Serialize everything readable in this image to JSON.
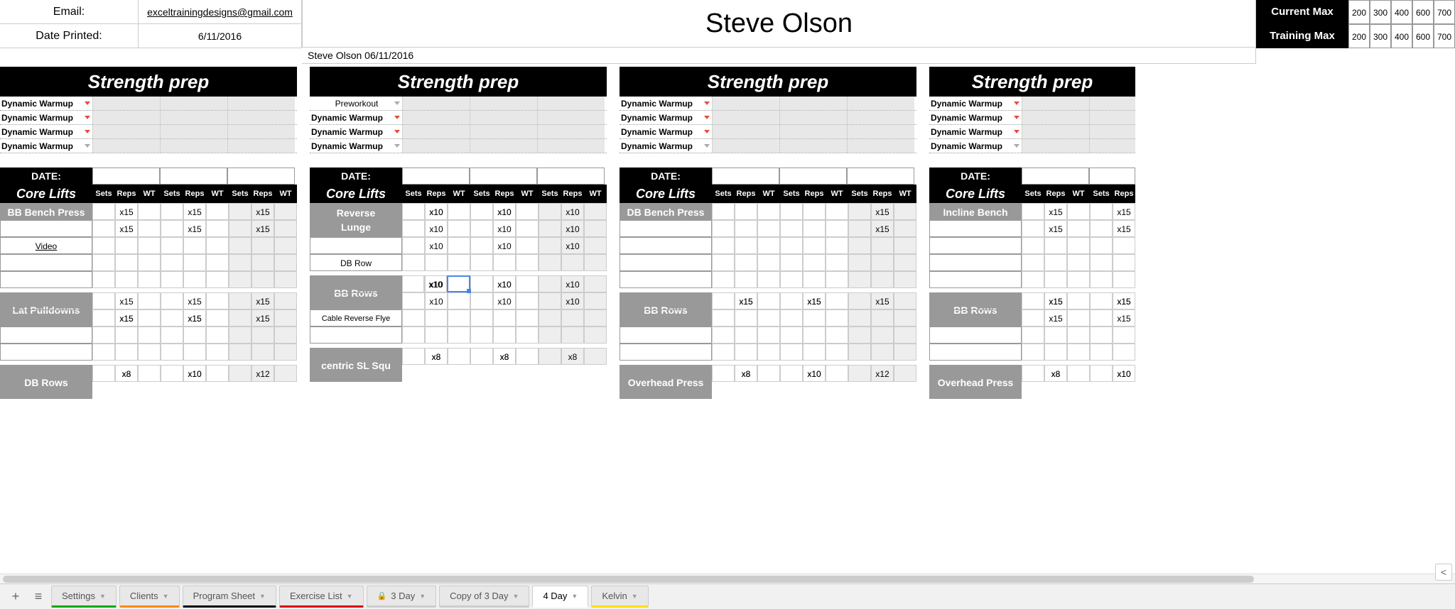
{
  "info": {
    "emailLabel": "Email:",
    "emailValue": "exceltrainingdesigns@gmail.com",
    "dateLabel": "Date Printed:",
    "dateValue": "6/11/2016"
  },
  "name": "Steve Olson",
  "subName": "Steve Olson 06/11/2016",
  "max": {
    "currentLabel": "Current Max",
    "trainingLabel": "Training Max",
    "current": [
      "200",
      "300",
      "400",
      "600",
      "700"
    ],
    "training": [
      "200",
      "300",
      "400",
      "600",
      "700"
    ]
  },
  "headers": {
    "strengthPrep": "Strength prep",
    "date": "DATE:",
    "coreLifts": "Core Lifts",
    "cols": [
      "Sets",
      "Reps",
      "WT"
    ]
  },
  "warmups": {
    "dyn": "Dynamic Warmup",
    "pre": "Preworkout"
  },
  "day1": {
    "ex1": "BB Bench Press",
    "video": "Video",
    "ex2": "Lat Pulldowns",
    "ex3": "DB Rows",
    "r": {
      "x15": "x15",
      "x8": "x8",
      "x10": "x10",
      "x12": "x12"
    }
  },
  "day2": {
    "ex1a": "Reverse",
    "ex1b": "Lunge",
    "ex2": "DB Row",
    "ex3": "BB Rows",
    "ex4": "Cable Reverse Flye",
    "ex5": "centric SL Squ",
    "r": {
      "x10": "x10",
      "x8": "x8"
    }
  },
  "day3": {
    "ex1": "DB Bench Press",
    "ex2": "BB Rows",
    "ex3": "Overhead Press",
    "r": {
      "x15": "x15",
      "x8": "x8",
      "x10": "x10",
      "x12": "x12"
    }
  },
  "day4": {
    "ex1": "Incline Bench",
    "ex2": "BB Rows",
    "ex3": "Overhead Press",
    "r": {
      "x15": "x15",
      "x8": "x8",
      "x10": "x10"
    }
  },
  "tabs": {
    "settings": "Settings",
    "clients": "Clients",
    "program": "Program Sheet",
    "exercise": "Exercise List",
    "day3": "3 Day",
    "copy3": "Copy of 3 Day",
    "day4": "4 Day",
    "kelvin": "Kelvin"
  }
}
